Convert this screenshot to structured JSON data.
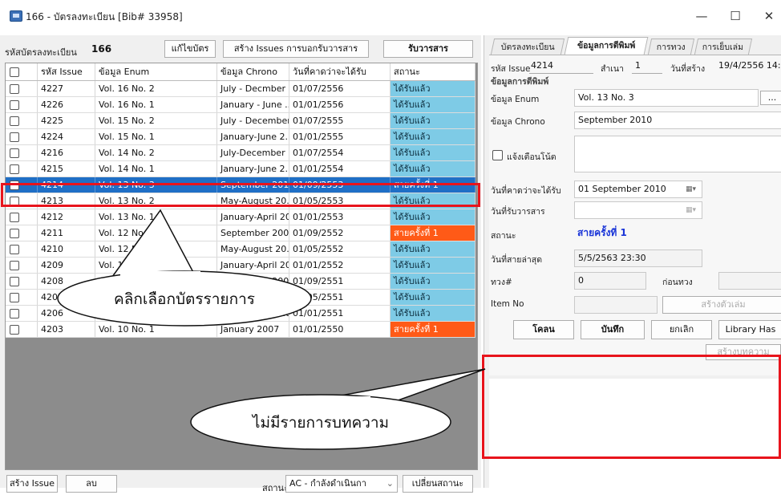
{
  "window": {
    "title": "166 - บัตรลงทะเบียน [Bib# 33958]",
    "minimize": "—",
    "maximize": "☐",
    "close": "✕"
  },
  "toolbar": {
    "reg_label": "รหัสบัตรลงทะเบียน",
    "reg_value": "166",
    "edit_button": "แก้ไขบัตร",
    "create_issues_button": "สร้าง Issues การบอกรับวารสาร",
    "receive_button": "รับวารสาร"
  },
  "table": {
    "headers": [
      "รหัส Issue",
      "ข้อมูล Enum",
      "ข้อมูล Chrono",
      "วันที่คาดว่าจะได้รับ",
      "สถานะ"
    ],
    "rows": [
      {
        "id": "4227",
        "enum": "Vol. 16 No. 2",
        "chrono": "July - Decmber ...",
        "expected": "01/07/2556",
        "status": "ได้รับแล้ว",
        "kind": "received"
      },
      {
        "id": "4226",
        "enum": "Vol. 16 No. 1",
        "chrono": "January - June ...",
        "expected": "01/01/2556",
        "status": "ได้รับแล้ว",
        "kind": "received"
      },
      {
        "id": "4225",
        "enum": "Vol. 15 No. 2",
        "chrono": "July - December...",
        "expected": "01/07/2555",
        "status": "ได้รับแล้ว",
        "kind": "received"
      },
      {
        "id": "4224",
        "enum": "Vol. 15 No. 1",
        "chrono": "January-June 2...",
        "expected": "01/01/2555",
        "status": "ได้รับแล้ว",
        "kind": "received"
      },
      {
        "id": "4216",
        "enum": "Vol. 14 No. 2",
        "chrono": "July-December ...",
        "expected": "01/07/2554",
        "status": "ได้รับแล้ว",
        "kind": "received"
      },
      {
        "id": "4215",
        "enum": "Vol. 14 No. 1",
        "chrono": "January-June 2...",
        "expected": "01/01/2554",
        "status": "ได้รับแล้ว",
        "kind": "received"
      },
      {
        "id": "4214",
        "enum": "Vol. 13 No. 3",
        "chrono": "September 2010",
        "expected": "01/09/2553",
        "status": "สายครั้งที่ 1",
        "kind": "selected"
      },
      {
        "id": "4213",
        "enum": "Vol. 13 No. 2",
        "chrono": "May-August 20...",
        "expected": "01/05/2553",
        "status": "ได้รับแล้ว",
        "kind": "received"
      },
      {
        "id": "4212",
        "enum": "Vol. 13 No. 1",
        "chrono": "January-April 20...",
        "expected": "01/01/2553",
        "status": "ได้รับแล้ว",
        "kind": "received"
      },
      {
        "id": "4211",
        "enum": "Vol. 12 No. 3",
        "chrono": "September 2009",
        "expected": "01/09/2552",
        "status": "สายครั้งที่ 1",
        "kind": "missing"
      },
      {
        "id": "4210",
        "enum": "Vol. 12 No. 2",
        "chrono": "May-August 20...",
        "expected": "01/05/2552",
        "status": "ได้รับแล้ว",
        "kind": "received"
      },
      {
        "id": "4209",
        "enum": "Vol. 12 No. 1",
        "chrono": "January-April 20...",
        "expected": "01/01/2552",
        "status": "ได้รับแล้ว",
        "kind": "received"
      },
      {
        "id": "4208",
        "enum": "Vol. 11 No. 3",
        "chrono": "September 2008",
        "expected": "01/09/2551",
        "status": "ได้รับแล้ว",
        "kind": "received"
      },
      {
        "id": "4207",
        "enum": "Vol. 11 No. 2",
        "chrono": "May-August 20...",
        "expected": "01/05/2551",
        "status": "ได้รับแล้ว",
        "kind": "received"
      },
      {
        "id": "4206",
        "enum": "Vol. 11 No. 1",
        "chrono": "January-April 20...",
        "expected": "01/01/2551",
        "status": "ได้รับแล้ว",
        "kind": "received"
      },
      {
        "id": "4203",
        "enum": "Vol. 10 No. 1",
        "chrono": "January 2007",
        "expected": "01/01/2550",
        "status": "สายครั้งที่ 1",
        "kind": "missing"
      }
    ]
  },
  "bottom_bar": {
    "create_issue_button": "สร้าง Issue",
    "delete_button": "ลบ",
    "status_label": "สถานะ",
    "status_select": "AC - กำลังดำเนินกา",
    "change_status_button": "เปลี่ยนสถานะ"
  },
  "right_panel": {
    "tabs": [
      "บัตรลงทะเบียน",
      "ข้อมูลการตีพิมพ์",
      "การทวง",
      "การเย็บเล่ม"
    ],
    "issue_id_label": "รหัส Issue",
    "issue_id_value": "4214",
    "copy_label": "สำเนา",
    "copy_value": "1",
    "created_label": "วันที่สร้าง",
    "created_value": "19/4/2556 14:2",
    "section_title": "ข้อมูลการตีพิมพ์",
    "enum_label": "ข้อมูล Enum",
    "enum_value": "Vol. 13 No. 3",
    "enum_more": "...",
    "chrono_label": "ข้อมูล Chrono",
    "chrono_value": "September 2010",
    "notify_label": "แจ้งเตือนโน้ต",
    "expected_label": "วันที่คาดว่าจะได้รับ",
    "expected_value": "01 September 2010",
    "received_label": "วันที่รับวารสาร",
    "status_label": "สถานะ",
    "status_value": "สายครั้งที่ 1",
    "last_late_label": "วันที่สายล่าสุด",
    "last_late_value": "5/5/2563 23:30",
    "claim_label": "ทวง#",
    "claim_value": "0",
    "before_claim_label": "ก่อนทวง",
    "item_no_label": "Item No",
    "create_copy_button": "สร้างตัวเล่ม",
    "clone_button": "โคลน",
    "save_button": "บันทึก",
    "cancel_button": "ยกเลิก",
    "library_has_button": "Library Has",
    "create_article_button": "สร้างบทความ"
  },
  "callouts": {
    "select_card": "คลิกเลือกบัตรรายการ",
    "no_articles": "ไม่มีรายการบทความ"
  },
  "colors": {
    "selected_row": "#1f6fc6",
    "received": "#7ecbe6",
    "missing": "#ff5a17",
    "highlight_box": "#e8141c",
    "status_text": "#1a35d8"
  }
}
